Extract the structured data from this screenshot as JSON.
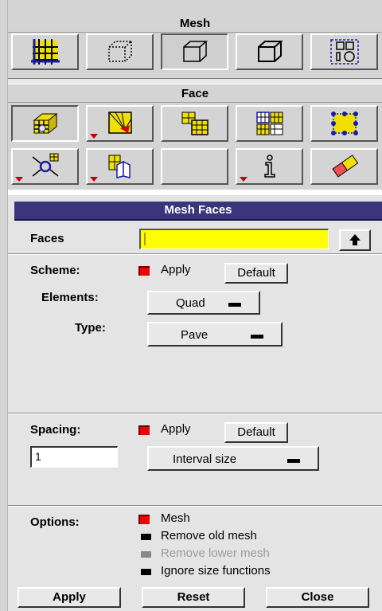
{
  "mesh_section": {
    "title": "Mesh",
    "buttons": [
      {
        "icon": "grid-mesh-icon",
        "selected": false
      },
      {
        "icon": "dashed-cube-icon",
        "selected": false
      },
      {
        "icon": "face-cube-icon",
        "selected": true
      },
      {
        "icon": "solid-cube-icon",
        "selected": false
      },
      {
        "icon": "group-shapes-icon",
        "selected": false
      }
    ]
  },
  "face_section": {
    "title": "Face",
    "buttons": [
      {
        "icon": "mesh-faces-icon",
        "selected": true
      },
      {
        "icon": "link-faces-icon",
        "selected": false
      },
      {
        "icon": "smooth-faces-icon",
        "selected": false
      },
      {
        "icon": "modify-mesh-icon",
        "selected": false
      },
      {
        "icon": "nodes-icon",
        "selected": false
      },
      {
        "icon": "move-nodes-icon",
        "selected": false
      },
      {
        "icon": "split-faces-icon",
        "selected": false
      },
      {
        "icon": "blank-icon",
        "selected": false
      },
      {
        "icon": "info-icon",
        "selected": false
      },
      {
        "icon": "eraser-icon",
        "selected": false
      }
    ]
  },
  "form": {
    "title": "Mesh Faces",
    "faces_label": "Faces",
    "faces_value": "",
    "scheme": {
      "label": "Scheme:",
      "apply_label": "Apply",
      "apply_checked": true,
      "default_label": "Default",
      "elements_label": "Elements:",
      "elements_value": "Quad",
      "type_label": "Type:",
      "type_value": "Pave"
    },
    "spacing": {
      "label": "Spacing:",
      "apply_label": "Apply",
      "apply_checked": true,
      "default_label": "Default",
      "value": "1",
      "method_value": "Interval size"
    },
    "options": {
      "label": "Options:",
      "items": [
        {
          "label": "Mesh",
          "checked": true,
          "enabled": true
        },
        {
          "label": "Remove old mesh",
          "checked": false,
          "enabled": true
        },
        {
          "label": "Remove lower mesh",
          "checked": false,
          "enabled": false
        },
        {
          "label": "Ignore size functions",
          "checked": false,
          "enabled": true
        }
      ]
    },
    "buttons": {
      "apply": "Apply",
      "reset": "Reset",
      "close": "Close"
    }
  }
}
